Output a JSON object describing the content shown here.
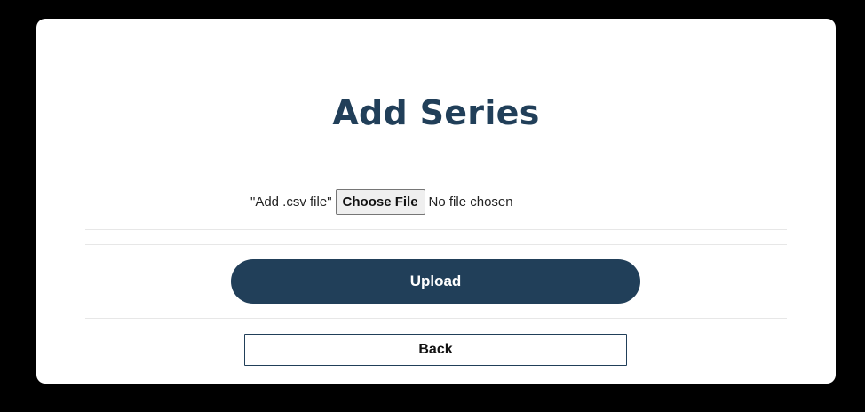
{
  "modal": {
    "title": "Add Series",
    "file_input": {
      "label": "\"Add .csv file\"",
      "button_label": "Choose File",
      "status_text": "No file chosen"
    },
    "upload_label": "Upload",
    "back_label": "Back"
  },
  "colors": {
    "brand_navy": "#213f59",
    "background": "#000000",
    "card": "#ffffff"
  }
}
